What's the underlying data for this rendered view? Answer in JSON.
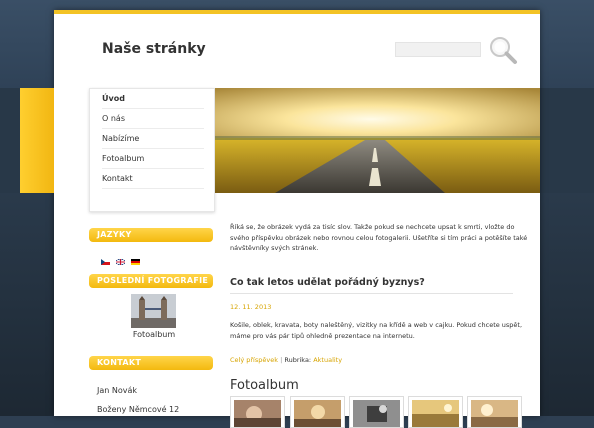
{
  "header": {
    "site_title": "Naše stránky",
    "search_placeholder": ""
  },
  "nav": {
    "items": [
      "Úvod",
      "O nás",
      "Nabízíme",
      "Fotoalbum",
      "Kontakt"
    ]
  },
  "sidebar": {
    "languages_title": "JAZYKY",
    "languages": [
      "cz-flag-icon",
      "uk-flag-icon",
      "de-flag-icon"
    ],
    "photos_title": "POSLEDNÍ FOTOGRAFIE",
    "photo_label": "Fotoalbum",
    "contact_title": "KONTAKT",
    "contact_lines": [
      "Jan Novák",
      "Boženy Němcové 12"
    ]
  },
  "main": {
    "intro": "Říká se, že obrázek vydá za tisíc slov. Takže pokud se nechcete upsat k smrti, vložte do svého příspěvku obrázek nebo rovnou celou fotogalerii. Ušetříte si tím práci a potěšíte také návštěvníky svých stránek.",
    "post": {
      "title": "Co tak letos udělat pořádný byznys?",
      "date": "12. 11. 2013",
      "body": "Košile, oblek, kravata, boty naleštěný, vizitky na křídě a web v cajku. Pokud chcete uspět, máme pro vás pár tipů ohledně prezentace na internetu.",
      "read_more": "Celý příspěvek",
      "separator": "|",
      "category_label": "Rubrika:",
      "category": "Aktuality"
    },
    "album_title": "Fotoalbum"
  },
  "colors": {
    "accent": "#f3c325",
    "link": "#d7a400",
    "background": "#2e3f52"
  }
}
